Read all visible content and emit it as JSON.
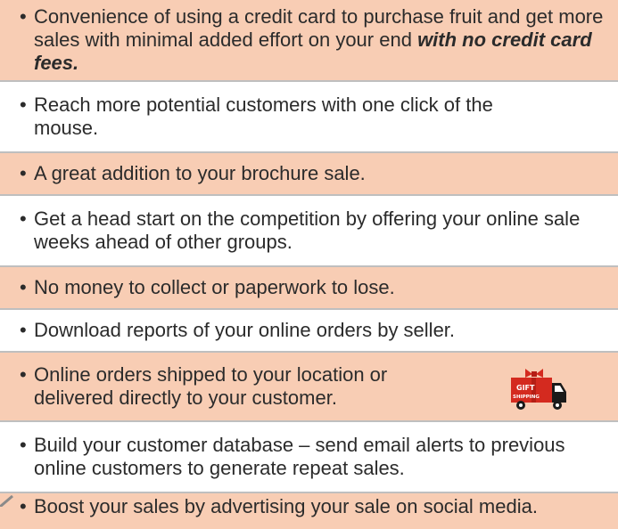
{
  "bullet": "•",
  "items": [
    {
      "text": "Convenience of using a credit card to purchase fruit and get more sales with minimal added effort on your end ",
      "emphasis": "with no credit card fees."
    },
    {
      "text": "Reach more potential customers with one click of the mouse."
    },
    {
      "text": "A great addition to your brochure sale."
    },
    {
      "text": "Get a head start on the competition by offering your online sale weeks ahead of other groups."
    },
    {
      "text": "No money to collect or paperwork to lose."
    },
    {
      "text": "Download reports of your online orders by seller."
    },
    {
      "text": "Online orders shipped to your location or delivered directly to your customer."
    },
    {
      "text": "Build your customer database – send email alerts to previous online customers to generate repeat sales."
    },
    {
      "text": "Boost your sales by advertising your sale on social media."
    }
  ],
  "truck_icon": {
    "name": "gift-shipping-truck-icon",
    "label_top": "GIFT",
    "label_bottom": "SHIPPING"
  },
  "colors": {
    "shaded_row": "#f8cdb4",
    "text": "#2b2b2b",
    "divider": "#bfbfbf",
    "truck_red": "#d42a1f",
    "truck_dark": "#1a1a1a"
  }
}
